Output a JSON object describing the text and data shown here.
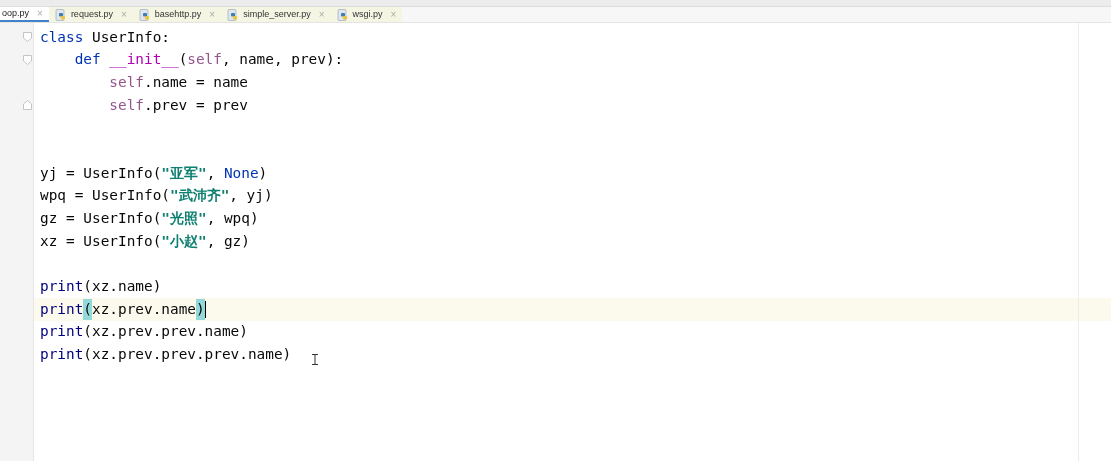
{
  "tabs": [
    {
      "label": "oop.py",
      "selected": true,
      "close": "×"
    },
    {
      "label": "request.py",
      "selected": false,
      "close": "×"
    },
    {
      "label": "basehttp.py",
      "selected": false,
      "close": "×"
    },
    {
      "label": "simple_server.py",
      "selected": false,
      "close": "×"
    },
    {
      "label": "wsgi.py",
      "selected": false,
      "close": "×"
    }
  ],
  "editor": {
    "lines": [
      {
        "kind": "code",
        "current": false,
        "fold_start": true,
        "fold_end": false,
        "tokens": [
          {
            "kind": "keyword",
            "text": "class "
          },
          {
            "kind": "plain",
            "text": "UserInfo:"
          }
        ]
      },
      {
        "kind": "code",
        "current": false,
        "fold_start": true,
        "fold_end": false,
        "tokens": [
          {
            "kind": "keyword",
            "text": "    def "
          },
          {
            "kind": "magic",
            "text": "__init__"
          },
          {
            "kind": "plain",
            "text": "("
          },
          {
            "kind": "self",
            "text": "self"
          },
          {
            "kind": "plain",
            "text": ", name, prev):"
          }
        ]
      },
      {
        "kind": "code",
        "current": false,
        "fold_start": false,
        "fold_end": false,
        "tokens": [
          {
            "kind": "self",
            "text": "        self"
          },
          {
            "kind": "plain",
            "text": ".name = name"
          }
        ]
      },
      {
        "kind": "code",
        "current": false,
        "fold_start": false,
        "fold_end": true,
        "tokens": [
          {
            "kind": "self",
            "text": "        self"
          },
          {
            "kind": "plain",
            "text": ".prev = prev"
          }
        ]
      },
      {
        "kind": "blank"
      },
      {
        "kind": "blank"
      },
      {
        "kind": "code",
        "current": false,
        "fold_start": false,
        "fold_end": false,
        "tokens": [
          {
            "kind": "plain",
            "text": "yj = UserInfo("
          },
          {
            "kind": "string",
            "text": "\"亚军\""
          },
          {
            "kind": "plain",
            "text": ", "
          },
          {
            "kind": "keyword",
            "text": "None"
          },
          {
            "kind": "plain",
            "text": ")"
          }
        ]
      },
      {
        "kind": "code",
        "current": false,
        "fold_start": false,
        "fold_end": false,
        "tokens": [
          {
            "kind": "plain",
            "text": "wpq = UserInfo("
          },
          {
            "kind": "string",
            "text": "\"武沛齐\""
          },
          {
            "kind": "plain",
            "text": ", yj)"
          }
        ]
      },
      {
        "kind": "code",
        "current": false,
        "fold_start": false,
        "fold_end": false,
        "tokens": [
          {
            "kind": "plain",
            "text": "gz = UserInfo("
          },
          {
            "kind": "string",
            "text": "\"光照\""
          },
          {
            "kind": "plain",
            "text": ", wpq)"
          }
        ]
      },
      {
        "kind": "code",
        "current": false,
        "fold_start": false,
        "fold_end": false,
        "tokens": [
          {
            "kind": "plain",
            "text": "xz = UserInfo("
          },
          {
            "kind": "string",
            "text": "\"小赵\""
          },
          {
            "kind": "plain",
            "text": ", gz)"
          }
        ]
      },
      {
        "kind": "blank"
      },
      {
        "kind": "code",
        "current": false,
        "fold_start": false,
        "fold_end": false,
        "tokens": [
          {
            "kind": "builtin",
            "text": "print"
          },
          {
            "kind": "plain",
            "text": "(xz.name)"
          }
        ]
      },
      {
        "kind": "code",
        "current": true,
        "fold_start": false,
        "fold_end": false,
        "tokens": [
          {
            "kind": "builtin",
            "text": "print"
          },
          {
            "kind": "match",
            "text": "("
          },
          {
            "kind": "plain",
            "text": "xz.prev.name"
          },
          {
            "kind": "match",
            "text": ")"
          },
          {
            "kind": "caret"
          }
        ]
      },
      {
        "kind": "code",
        "current": false,
        "fold_start": false,
        "fold_end": false,
        "tokens": [
          {
            "kind": "builtin",
            "text": "print"
          },
          {
            "kind": "plain",
            "text": "(xz.prev.prev.name)"
          }
        ]
      },
      {
        "kind": "code",
        "current": false,
        "fold_start": false,
        "fold_end": false,
        "tokens": [
          {
            "kind": "builtin",
            "text": "print"
          },
          {
            "kind": "plain",
            "text": "(xz.prev.prev.prev.name)"
          }
        ]
      }
    ]
  }
}
